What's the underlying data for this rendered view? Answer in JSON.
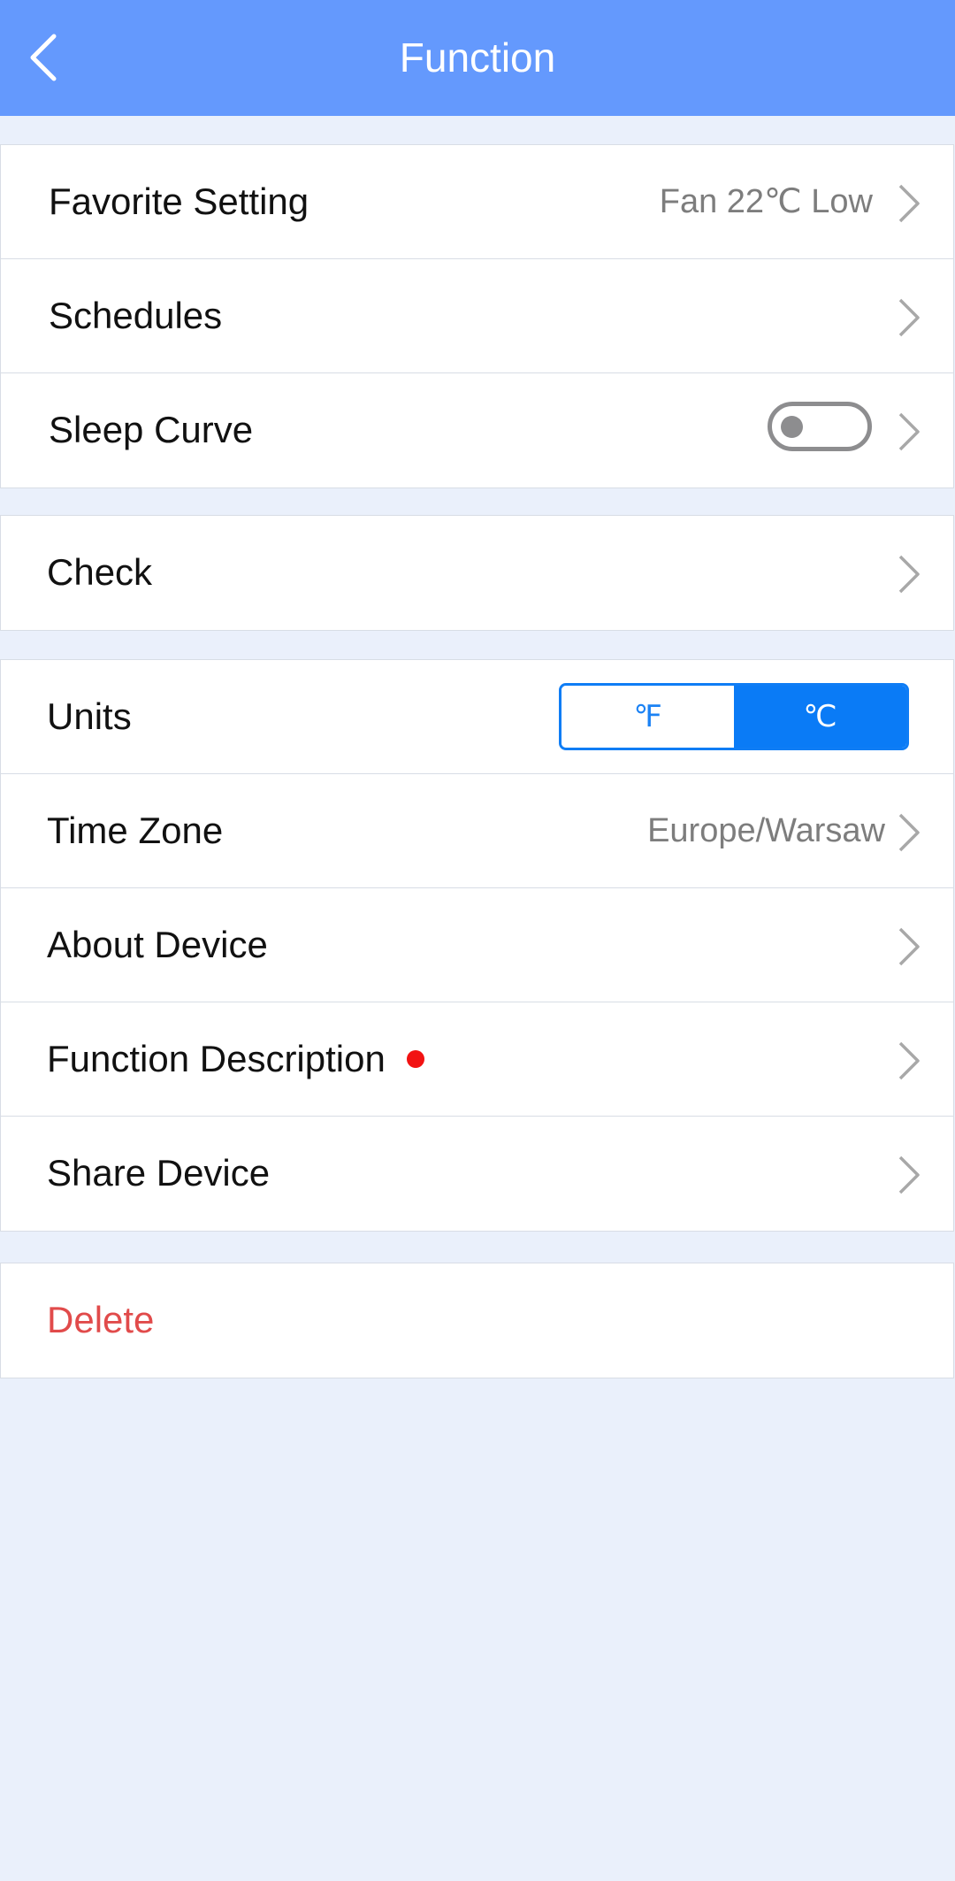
{
  "header": {
    "title": "Function",
    "back_icon": "chevron-left-icon"
  },
  "group1": {
    "favorite": {
      "label": "Favorite Setting",
      "value": "Fan 22℃ Low"
    },
    "schedules": {
      "label": "Schedules"
    },
    "sleep_curve": {
      "label": "Sleep Curve",
      "toggle_on": false
    }
  },
  "group2": {
    "check": {
      "label": "Check"
    }
  },
  "group3": {
    "units": {
      "label": "Units",
      "fahrenheit": "℉",
      "celsius": "℃",
      "selected": "celsius"
    },
    "time_zone": {
      "label": "Time Zone",
      "value": "Europe/Warsaw"
    },
    "about_device": {
      "label": "About Device"
    },
    "function_description": {
      "label": "Function Description",
      "has_badge": true
    },
    "share_device": {
      "label": "Share Device"
    }
  },
  "group4": {
    "delete": {
      "label": "Delete"
    }
  },
  "colors": {
    "header_bg": "#6499fd",
    "accent": "#0a7bf6",
    "danger": "#e14b4b",
    "badge": "#f21212",
    "page_bg": "#eaf0fb"
  }
}
